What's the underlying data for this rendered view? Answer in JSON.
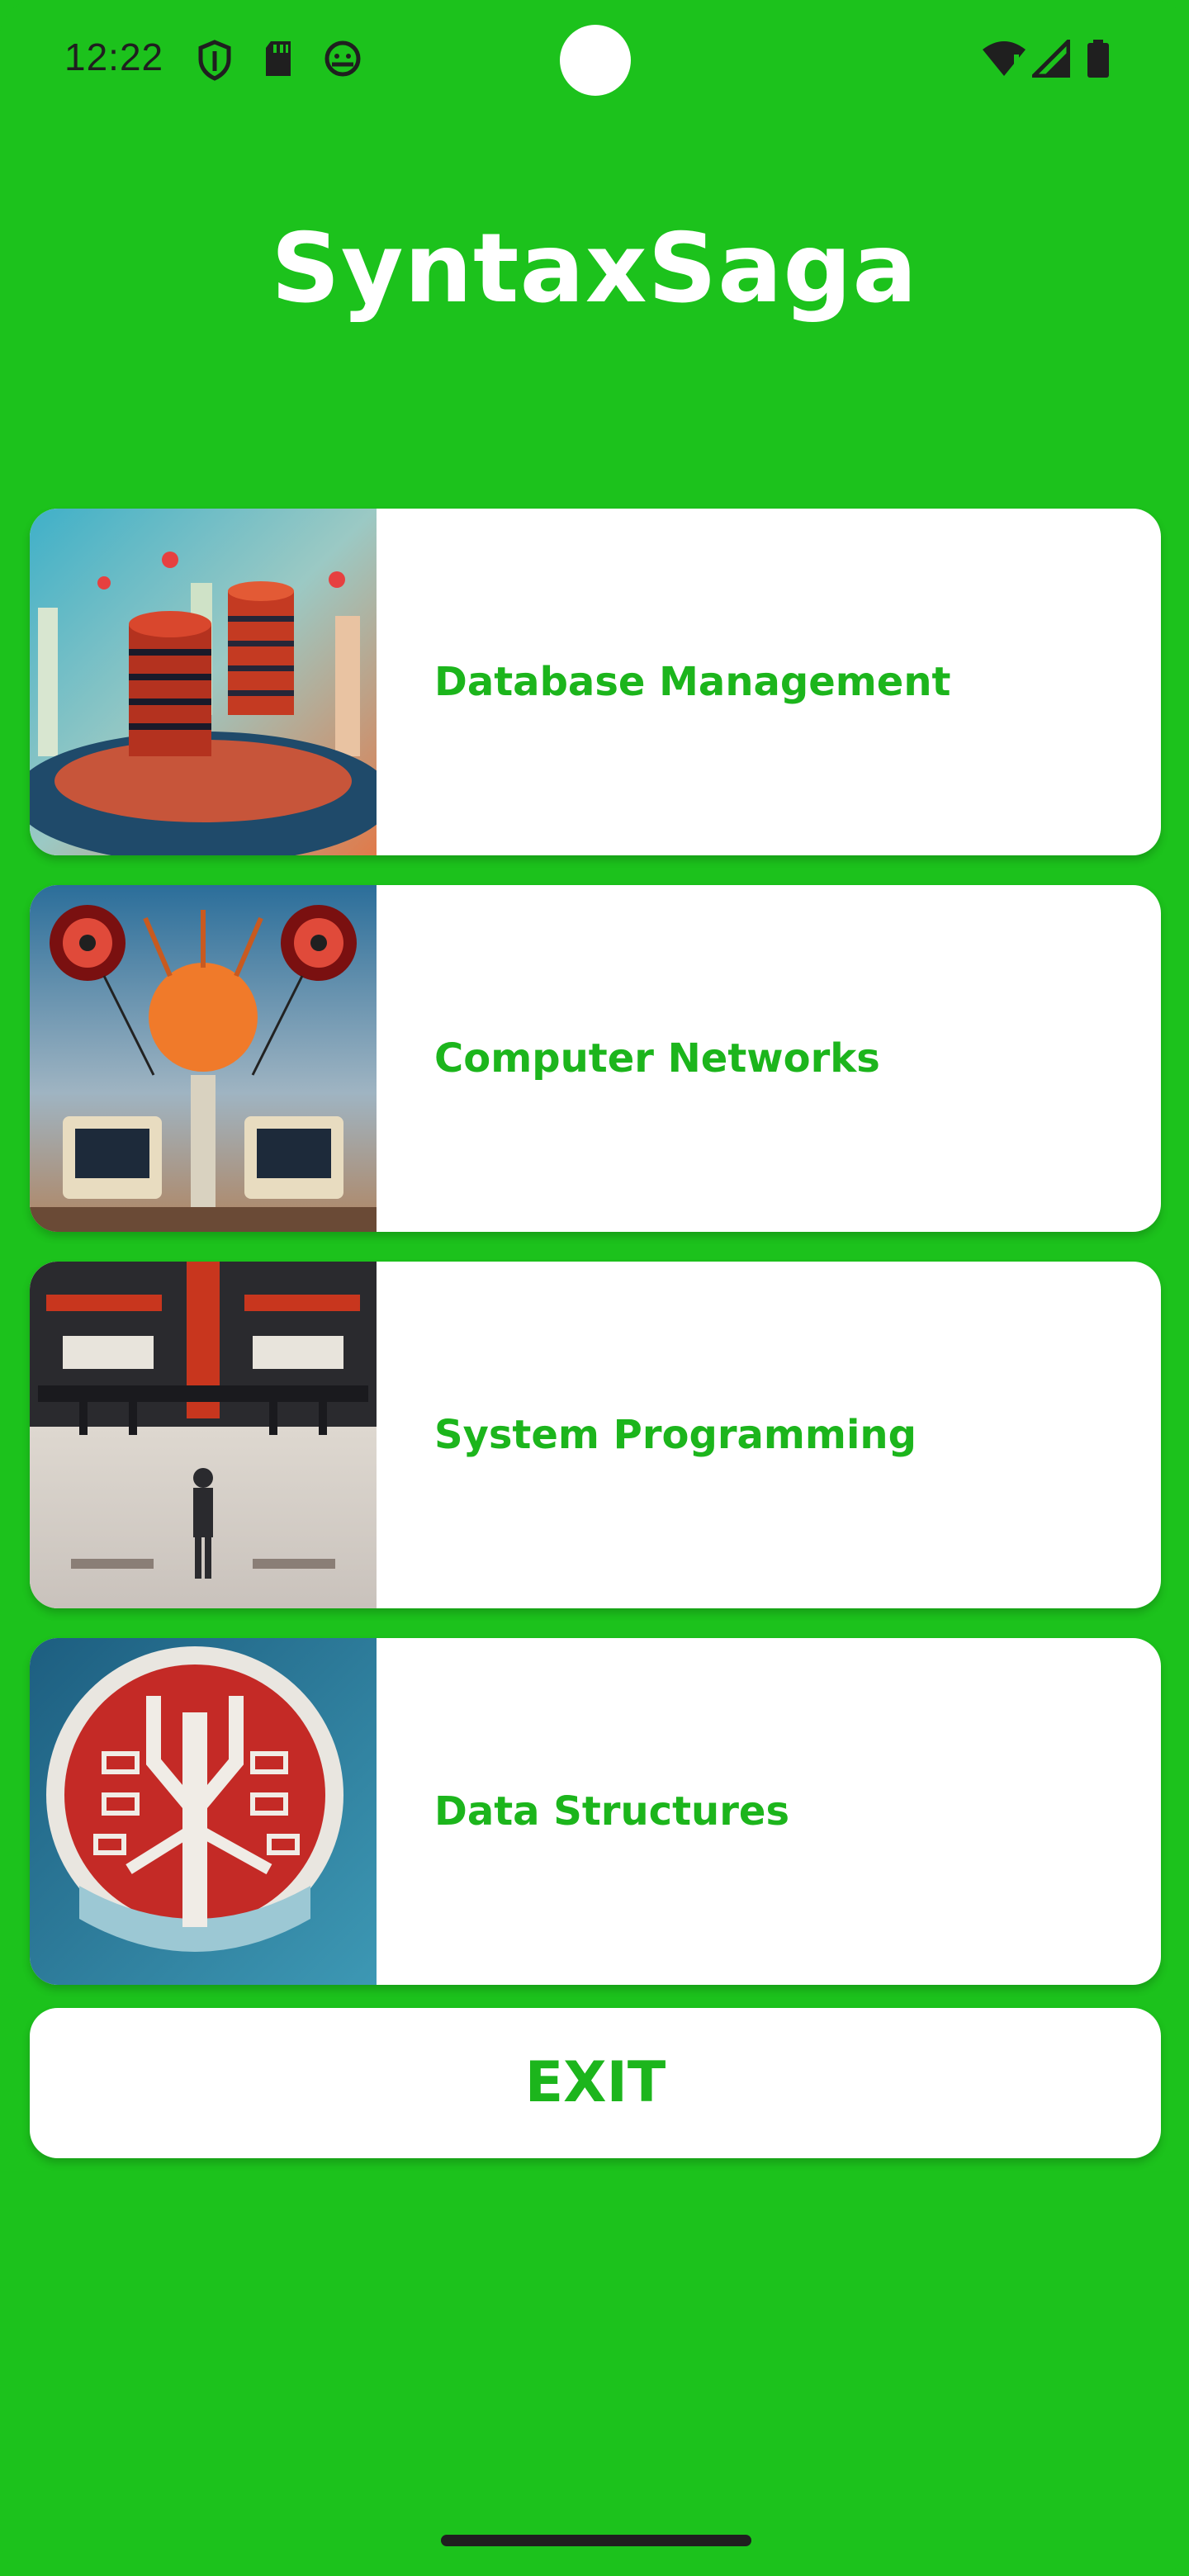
{
  "status_bar": {
    "time": "12:22",
    "icons": [
      "shield-icon",
      "sd-card-icon",
      "android-icon",
      "wifi-icon",
      "signal-icon",
      "battery-icon"
    ]
  },
  "app": {
    "title": "SyntaxSaga"
  },
  "subjects": [
    {
      "label": "Database Management",
      "image": "database-illustration"
    },
    {
      "label": "Computer Networks",
      "image": "network-illustration"
    },
    {
      "label": "System Programming",
      "image": "system-illustration"
    },
    {
      "label": "Data Structures",
      "image": "tree-structure-illustration"
    }
  ],
  "exit_button": {
    "label": "EXIT"
  },
  "colors": {
    "background": "#1cc21c",
    "accent_text": "#1cb51c",
    "card": "#ffffff"
  }
}
